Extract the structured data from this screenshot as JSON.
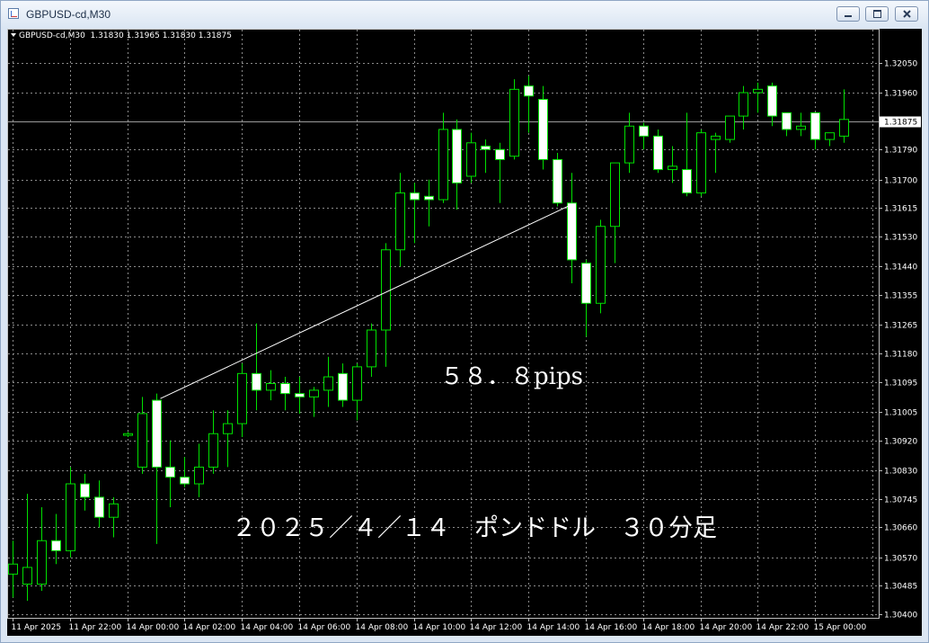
{
  "window": {
    "title": "GBPUSD-cd,M30",
    "buttons": [
      "minimize",
      "restore",
      "close"
    ]
  },
  "colors": {
    "background": "#000000",
    "grid": "#8a8a8a",
    "candle": "#00e000",
    "bull_body": "#000000",
    "bear_body": "#ffffff",
    "trend_line": "#ffffff",
    "label": "#ffffff"
  },
  "chart_header": {
    "symbol": "GBPUSD-cd,M30",
    "ohlc": "1.31830 1.31965 1.31830 1.31875"
  },
  "current_price_label": "1.31875",
  "annotations": {
    "pips": "５８．８pips",
    "title": "２０２５／４／１４　ポンドドル　３０分足"
  },
  "chart_data": {
    "type": "candlestick",
    "timeframe": "M30",
    "y_ticks": [
      "1.32050",
      "1.31960",
      "1.31875",
      "1.31790",
      "1.31700",
      "1.31615",
      "1.31530",
      "1.31440",
      "1.31355",
      "1.31265",
      "1.31180",
      "1.31095",
      "1.31005",
      "1.30920",
      "1.30830",
      "1.30745",
      "1.30660",
      "1.30570",
      "1.30485",
      "1.30400"
    ],
    "ylim": [
      1.304,
      1.321
    ],
    "x_ticks": [
      "11 Apr 2025",
      "11 Apr 22:00",
      "14 Apr 00:00",
      "14 Apr 02:00",
      "14 Apr 04:00",
      "14 Apr 06:00",
      "14 Apr 08:00",
      "14 Apr 10:00",
      "14 Apr 12:00",
      "14 Apr 14:00",
      "14 Apr 16:00",
      "14 Apr 18:00",
      "14 Apr 20:00",
      "14 Apr 22:00",
      "15 Apr 00:00"
    ],
    "candles": [
      {
        "o": 1.3052,
        "h": 1.3062,
        "l": 1.3045,
        "c": 1.3055
      },
      {
        "o": 1.3049,
        "h": 1.3076,
        "l": 1.3044,
        "c": 1.3054
      },
      {
        "o": 1.3049,
        "h": 1.3072,
        "l": 1.3047,
        "c": 1.3062
      },
      {
        "o": 1.3062,
        "h": 1.307,
        "l": 1.3055,
        "c": 1.3059
      },
      {
        "o": 1.3059,
        "h": 1.3084,
        "l": 1.3057,
        "c": 1.3079
      },
      {
        "o": 1.3079,
        "h": 1.3082,
        "l": 1.3071,
        "c": 1.3075
      },
      {
        "o": 1.3075,
        "h": 1.308,
        "l": 1.3066,
        "c": 1.3069
      },
      {
        "o": 1.3069,
        "h": 1.3075,
        "l": 1.3063,
        "c": 1.3073
      },
      {
        "o": 1.30935,
        "h": 1.30945,
        "l": 1.3093,
        "c": 1.3094
      },
      {
        "o": 1.3084,
        "h": 1.3105,
        "l": 1.3082,
        "c": 1.31
      },
      {
        "o": 1.3104,
        "h": 1.3106,
        "l": 1.3061,
        "c": 1.3084
      },
      {
        "o": 1.3084,
        "h": 1.3092,
        "l": 1.3072,
        "c": 1.3081
      },
      {
        "o": 1.3081,
        "h": 1.3087,
        "l": 1.3078,
        "c": 1.3079
      },
      {
        "o": 1.3079,
        "h": 1.3091,
        "l": 1.3075,
        "c": 1.3084
      },
      {
        "o": 1.3084,
        "h": 1.3101,
        "l": 1.3082,
        "c": 1.3094
      },
      {
        "o": 1.3094,
        "h": 1.3101,
        "l": 1.3084,
        "c": 1.3097
      },
      {
        "o": 1.3097,
        "h": 1.3115,
        "l": 1.3093,
        "c": 1.3112
      },
      {
        "o": 1.3112,
        "h": 1.3127,
        "l": 1.3101,
        "c": 1.3107
      },
      {
        "o": 1.3107,
        "h": 1.3113,
        "l": 1.3104,
        "c": 1.3109
      },
      {
        "o": 1.3109,
        "h": 1.3111,
        "l": 1.3101,
        "c": 1.3106
      },
      {
        "o": 1.3106,
        "h": 1.3111,
        "l": 1.31,
        "c": 1.3105
      },
      {
        "o": 1.3105,
        "h": 1.3108,
        "l": 1.3099,
        "c": 1.3107
      },
      {
        "o": 1.3107,
        "h": 1.3117,
        "l": 1.3102,
        "c": 1.3111
      },
      {
        "o": 1.3112,
        "h": 1.3115,
        "l": 1.3102,
        "c": 1.3104
      },
      {
        "o": 1.3104,
        "h": 1.3115,
        "l": 1.3098,
        "c": 1.3114
      },
      {
        "o": 1.3114,
        "h": 1.3127,
        "l": 1.3111,
        "c": 1.3125
      },
      {
        "o": 1.3125,
        "h": 1.3151,
        "l": 1.3114,
        "c": 1.3149
      },
      {
        "o": 1.3149,
        "h": 1.3172,
        "l": 1.3144,
        "c": 1.3166
      },
      {
        "o": 1.3166,
        "h": 1.3169,
        "l": 1.3151,
        "c": 1.3164
      },
      {
        "o": 1.3165,
        "h": 1.317,
        "l": 1.3156,
        "c": 1.3164
      },
      {
        "o": 1.3164,
        "h": 1.319,
        "l": 1.3163,
        "c": 1.3185
      },
      {
        "o": 1.3185,
        "h": 1.3188,
        "l": 1.3161,
        "c": 1.3169
      },
      {
        "o": 1.3171,
        "h": 1.3184,
        "l": 1.3169,
        "c": 1.3181
      },
      {
        "o": 1.318,
        "h": 1.3182,
        "l": 1.3172,
        "c": 1.3179
      },
      {
        "o": 1.3179,
        "h": 1.3181,
        "l": 1.3163,
        "c": 1.3176
      },
      {
        "o": 1.3177,
        "h": 1.32,
        "l": 1.3176,
        "c": 1.3197
      },
      {
        "o": 1.3198,
        "h": 1.3201,
        "l": 1.3184,
        "c": 1.3195
      },
      {
        "o": 1.3194,
        "h": 1.3198,
        "l": 1.3173,
        "c": 1.3176
      },
      {
        "o": 1.3176,
        "h": 1.3178,
        "l": 1.3162,
        "c": 1.3163
      },
      {
        "o": 1.3163,
        "h": 1.3172,
        "l": 1.3139,
        "c": 1.3146
      },
      {
        "o": 1.3145,
        "h": 1.3146,
        "l": 1.3123,
        "c": 1.3133
      },
      {
        "o": 1.3133,
        "h": 1.3158,
        "l": 1.313,
        "c": 1.3156
      },
      {
        "o": 1.3156,
        "h": 1.3175,
        "l": 1.3145,
        "c": 1.3175
      },
      {
        "o": 1.3175,
        "h": 1.319,
        "l": 1.3172,
        "c": 1.3186
      },
      {
        "o": 1.3186,
        "h": 1.3187,
        "l": 1.3179,
        "c": 1.3183
      },
      {
        "o": 1.3183,
        "h": 1.3185,
        "l": 1.3172,
        "c": 1.3173
      },
      {
        "o": 1.3173,
        "h": 1.318,
        "l": 1.3169,
        "c": 1.3174
      },
      {
        "o": 1.3173,
        "h": 1.319,
        "l": 1.3165,
        "c": 1.3166
      },
      {
        "o": 1.3166,
        "h": 1.3185,
        "l": 1.3165,
        "c": 1.3184
      },
      {
        "o": 1.3182,
        "h": 1.3184,
        "l": 1.3172,
        "c": 1.3183
      },
      {
        "o": 1.3182,
        "h": 1.3189,
        "l": 1.3181,
        "c": 1.3189
      },
      {
        "o": 1.3189,
        "h": 1.3198,
        "l": 1.3185,
        "c": 1.3196
      },
      {
        "o": 1.3196,
        "h": 1.3199,
        "l": 1.319,
        "c": 1.3197
      },
      {
        "o": 1.3198,
        "h": 1.3199,
        "l": 1.3186,
        "c": 1.3189
      },
      {
        "o": 1.319,
        "h": 1.319,
        "l": 1.3183,
        "c": 1.3185
      },
      {
        "o": 1.3185,
        "h": 1.319,
        "l": 1.3183,
        "c": 1.3186
      },
      {
        "o": 1.319,
        "h": 1.319,
        "l": 1.3179,
        "c": 1.3182
      },
      {
        "o": 1.3182,
        "h": 1.3184,
        "l": 1.318,
        "c": 1.3184
      },
      {
        "o": 1.3183,
        "h": 1.3197,
        "l": 1.3181,
        "c": 1.3188
      }
    ],
    "trend_line": {
      "from_candle": 10,
      "from_price": 1.31045,
      "to_candle": 39,
      "to_price": 1.31625
    }
  }
}
